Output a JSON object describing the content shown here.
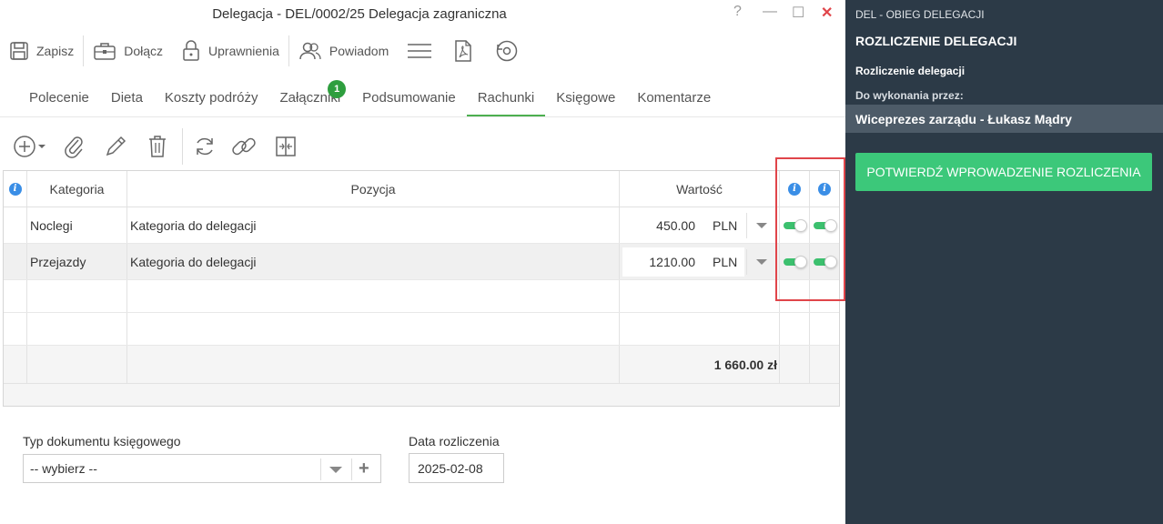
{
  "window": {
    "title": "Delegacja - DEL/0002/25 Delegacja zagraniczna",
    "help": "?",
    "minimize": "—",
    "maximize": "☐",
    "close": "✕"
  },
  "toolbar": {
    "save": "Zapisz",
    "attach": "Dołącz",
    "permissions": "Uprawnienia",
    "notify": "Powiadom"
  },
  "tabs": [
    {
      "label": "Polecenie"
    },
    {
      "label": "Dieta"
    },
    {
      "label": "Koszty podróży"
    },
    {
      "label": "Załączniki",
      "badge": "1"
    },
    {
      "label": "Podsumowanie"
    },
    {
      "label": "Rachunki",
      "active": true
    },
    {
      "label": "Księgowe"
    },
    {
      "label": "Komentarze"
    }
  ],
  "grid": {
    "headers": {
      "category": "Kategoria",
      "position": "Pozycja",
      "value": "Wartość"
    },
    "rows": [
      {
        "category": "Noclegi",
        "position": "Kategoria do delegacji",
        "value": "450.00",
        "currency": "PLN",
        "toggle1": true,
        "toggle2": true
      },
      {
        "category": "Przejazdy",
        "position": "Kategoria do delegacji",
        "value": "1210.00",
        "currency": "PLN",
        "toggle1": true,
        "toggle2": true
      }
    ],
    "total": "1 660.00 zł"
  },
  "form": {
    "doc_type_label": "Typ dokumentu księgowego",
    "doc_type_value": "-- wybierz --",
    "date_label": "Data rozliczenia",
    "date_value": "2025-02-08"
  },
  "side": {
    "workflow": "DEL - OBIEG DELEGACJI",
    "heading": "ROZLICZENIE DELEGACJI",
    "step_name": "Rozliczenie delegacji",
    "assigned_label": "Do wykonania przez:",
    "assignee": "Wiceprezes zarządu - Łukasz Mądry",
    "confirm_button": "POTWIERDŹ WPROWADZENIE ROZLICZENIA"
  },
  "colors": {
    "accent_green": "#3cc87a",
    "tab_underline": "#4caf50",
    "side_bg": "#2c3a47",
    "highlight_border": "#e0454a",
    "info_blue": "#3a8ee6"
  }
}
